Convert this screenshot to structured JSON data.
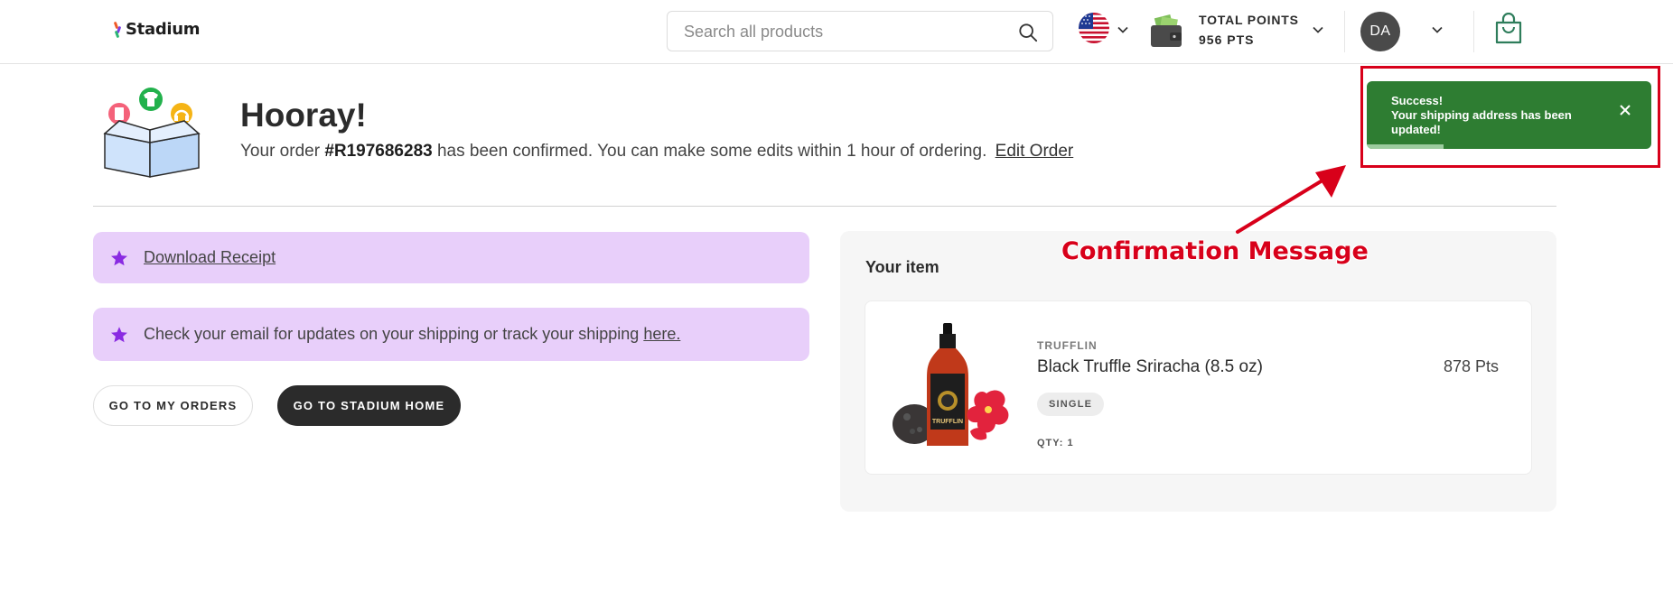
{
  "header": {
    "logo_text": "Stadium",
    "search_placeholder": "Search all products",
    "points_label": "TOTAL POINTS",
    "points_value": "956 PTS",
    "avatar_initials": "DA"
  },
  "hero": {
    "title": "Hooray!",
    "order_prefix": "Your order",
    "order_number": "#R197686283",
    "order_suffix": "has been confirmed. You can make some edits within 1 hour of ordering.",
    "edit_link": "Edit Order"
  },
  "notices": {
    "receipt_link": "Download Receipt",
    "shipping_text": "Check your email for updates on your shipping or track your shipping",
    "shipping_link": "here."
  },
  "buttons": {
    "orders": "GO TO MY ORDERS",
    "home": "GO TO STADIUM HOME"
  },
  "order_panel": {
    "title": "Your item",
    "item": {
      "brand": "TRUFFLIN",
      "name": "Black Truffle Sriracha (8.5 oz)",
      "price": "878 Pts",
      "variant": "SINGLE",
      "qty": "QTY: 1",
      "image_label": "TRUFFLIN"
    }
  },
  "toast": {
    "title": "Success!",
    "message": "Your shipping address has been updated!",
    "progress": 0.27,
    "color": "#2e7d32"
  },
  "annotation": {
    "label": "Confirmation Message",
    "color": "#d8001a"
  },
  "colors": {
    "notice_bg": "#e8cffa",
    "star": "#8a2be2",
    "dark_button": "#2b2b2b"
  }
}
